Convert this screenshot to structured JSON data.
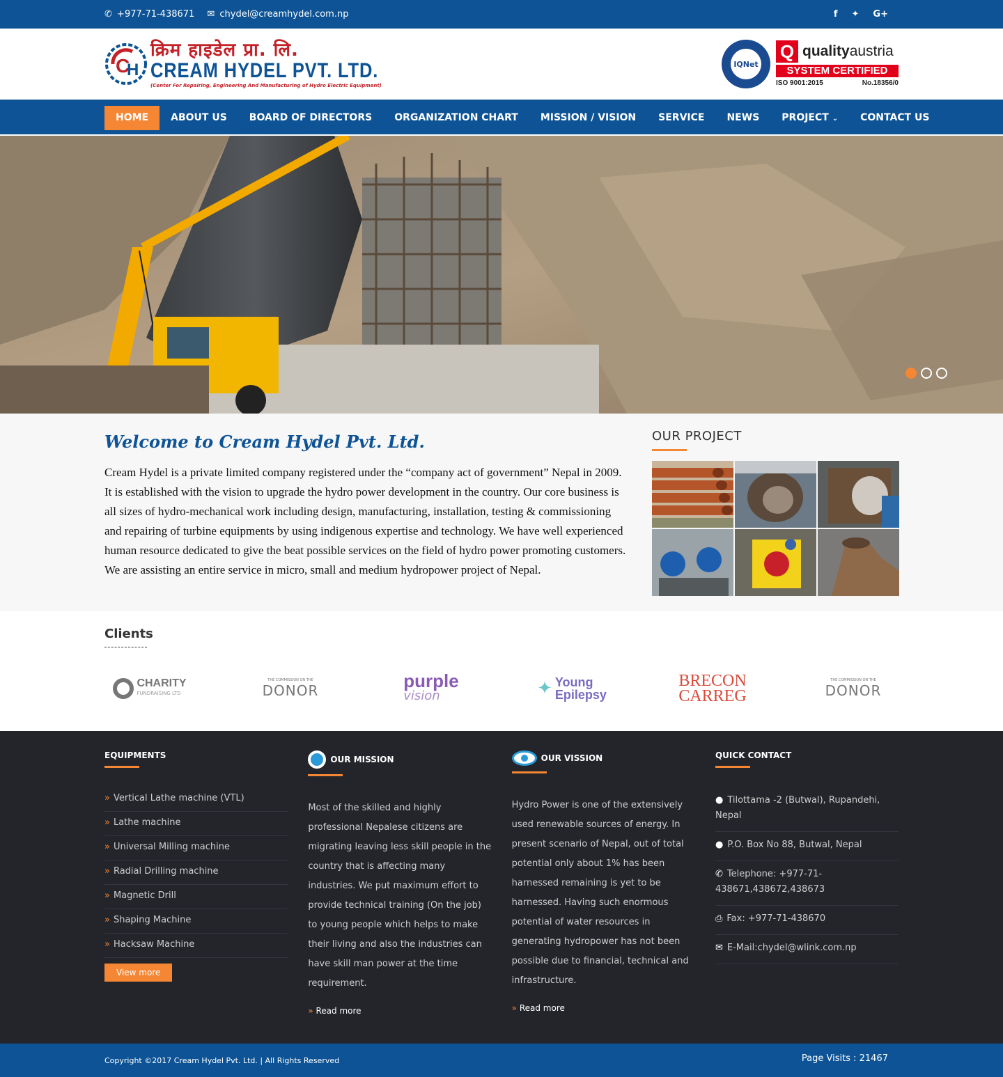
{
  "topbar": {
    "phone": "+977-71-438671",
    "email": "chydel@creamhydel.com.np",
    "social": [
      "f",
      "t",
      "G+"
    ]
  },
  "logo": {
    "nepali": "क्रिम हाइडेल प्रा. लि.",
    "name": "CREAM HYDEL PVT. LTD.",
    "tagline": "(Center For Repairing, Engineering And Manufacturing of Hydro Electric Equipment)"
  },
  "certs": {
    "iqnet": "IQNet",
    "qa_brand_a": "quality",
    "qa_brand_b": "austria",
    "qa_system": "SYSTEM CERTIFIED",
    "qa_iso": "ISO 9001:2015",
    "qa_no": "No.18356/0"
  },
  "nav": {
    "items": [
      {
        "label": "HOME"
      },
      {
        "label": "ABOUT US"
      },
      {
        "label": "BOARD OF DIRECTORS"
      },
      {
        "label": "ORGANIZATION CHART"
      },
      {
        "label": "MISSION / VISION"
      },
      {
        "label": "SERVICE"
      },
      {
        "label": "NEWS"
      },
      {
        "label": "PROJECT"
      },
      {
        "label": "CONTACT US"
      }
    ]
  },
  "welcome": {
    "title": "Welcome to Cream Hydel Pvt. Ltd.",
    "text": "Cream Hydel is a private limited company registered under the “company act of government” Nepal in 2009. It is established with the vision to upgrade the hydro power development in the country. Our core business is all sizes of hydro-mechanical work including design, manufacturing, installation, testing & commissioning and repairing of turbine equipments by using indigenous expertise and technology. We have well experienced human resource dedicated to give the beat possible services on the field of hydro power promoting customers. We are assisting an entire service in micro, small and medium hydropower project of Nepal."
  },
  "project": {
    "title": "OUR PROJECT"
  },
  "clients": {
    "title": "Clients",
    "logos": [
      {
        "a": "CHARITY",
        "b": "FUNDRAISING LTD"
      },
      {
        "a": "DONOR",
        "b": "THE COMMISSION ON THE"
      },
      {
        "a": "purple",
        "b": "vision"
      },
      {
        "a": "Young",
        "b": "Epilepsy"
      },
      {
        "a": "BRECON",
        "b": "CARREG"
      },
      {
        "a": "DONOR",
        "b": "THE COMMISSION ON THE"
      }
    ]
  },
  "footer": {
    "equipments_title": "EQUIPMENTS",
    "equipments": [
      "Vertical Lathe machine (VTL)",
      "Lathe machine",
      "Universal Milling machine",
      "Radial Drilling machine",
      "Magnetic Drill",
      "Shaping Machine",
      "Hacksaw Machine"
    ],
    "view_more": "View more",
    "mission_title": "OUR MISSION",
    "mission_text": "Most of the skilled and highly professional Nepalese citizens are migrating leaving less skill people in the country that is affecting many industries. We put maximum effort to provide technical training (On the job) to young people which helps to make their living and also the industries can have skill man power at the time requirement.",
    "vision_title": "OUR VISSION",
    "vision_text": "Hydro Power is one of the extensively used renewable sources of energy. In present scenario of Nepal, out of total potential only about 1% has been harnessed remaining is yet to be harnessed. Having such enormous potential of water resources in generating hydropower has not been possible due to financial, technical and infrastructure.",
    "read_more": "Read more",
    "quick_title": "QUICK CONTACT",
    "address": "Tilottama -2 (Butwal), Rupandehi, Nepal",
    "pobox": "P.O. Box No 88, Butwal, Nepal",
    "telephone": "Telephone: +977-71-438671,438672,438673",
    "fax": "Fax: +977-71-438670",
    "email": "E-Mail:chydel@wlink.com.np"
  },
  "bottom": {
    "copyright": "Copyright ©2017 Cream Hydel Pvt. Ltd. | All Rights Reserved",
    "visits": "Page Visits : 21467"
  },
  "colors": {
    "primary": "#0d5395",
    "accent": "#f58634",
    "footer_bg": "#23252b"
  }
}
